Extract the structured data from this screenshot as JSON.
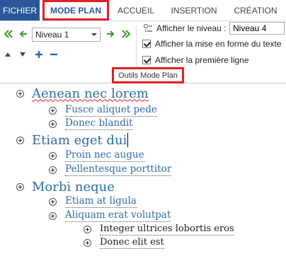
{
  "tabs": {
    "file": "FICHIER",
    "outline": "MODE PLAN",
    "home": "ACCUEIL",
    "insert": "INSERTION",
    "create": "CRÉATION"
  },
  "ribbon": {
    "level_value": "Niveau 1",
    "show_level_label": "Afficher le niveau :",
    "show_level_value": "Niveau 4",
    "show_text_formatting": "Afficher la mise en forme du texte",
    "show_first_line": "Afficher la première ligne",
    "group_label": "Outils Mode Plan",
    "show_text_formatting_checked": true,
    "show_first_line_checked": true
  },
  "outline": [
    {
      "text": "Aenean nec lorem",
      "level": 1
    },
    {
      "text": "Fusce aliquet pede",
      "level": 2
    },
    {
      "text": "Donec blandit",
      "level": 2
    },
    {
      "text": "Etiam eget dui",
      "level": 1
    },
    {
      "text": "Proin nec augue",
      "level": 2
    },
    {
      "text": "Pellentesque porttitor",
      "level": 2
    },
    {
      "text": "Morbi neque",
      "level": 1
    },
    {
      "text": "Etiam at ligula",
      "level": 2
    },
    {
      "text": "Aliquam erat volutpat",
      "level": 2
    },
    {
      "text": "Integer ultrices lobortis eros",
      "level": 3
    },
    {
      "text": "Donec elit est",
      "level": 3
    }
  ],
  "colors": {
    "accent": "#2b579a",
    "highlight": "#e41e26",
    "heading": "#2e6ca4"
  }
}
